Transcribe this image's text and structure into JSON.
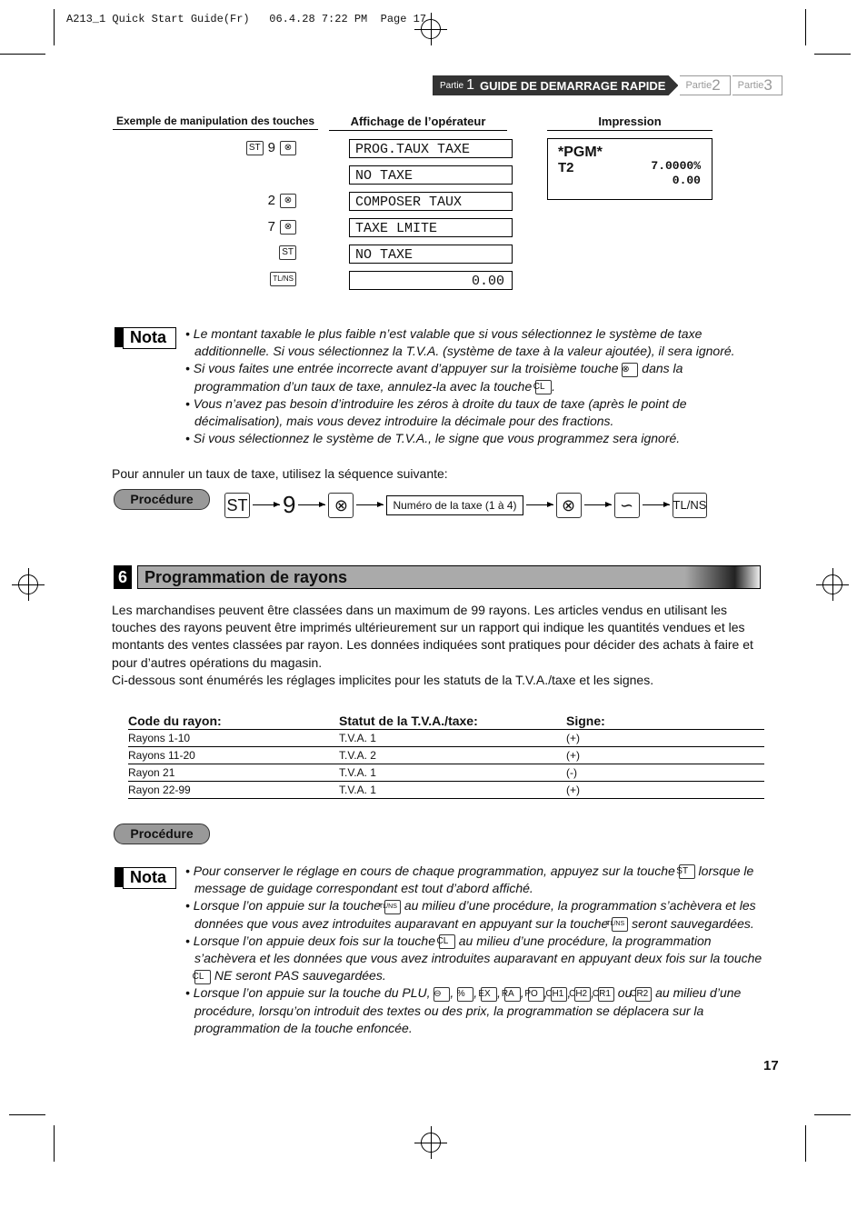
{
  "slug": "A213_1 Quick Start Guide(Fr)   06.4.28 7:22 PM  Page 17",
  "header": {
    "cur_prefix": "Partie",
    "cur_num": "1",
    "cur_title": "GUIDE DE DEMARRAGE RAPIDE",
    "others": [
      {
        "p": "Partie",
        "n": "2"
      },
      {
        "p": "Partie",
        "n": "3"
      }
    ]
  },
  "example": {
    "col1": "Exemple de manipulation des touches",
    "col2": "Affichage de l’opérateur",
    "col3": "Impression",
    "rows": [
      {
        "keys": [
          "ST",
          "9",
          "⊗"
        ],
        "display": "PROG.TAUX TAXE"
      },
      {
        "keys": [],
        "display": "NO TAXE"
      },
      {
        "keys": [
          "2",
          "⊗"
        ],
        "display": "COMPOSER TAUX"
      },
      {
        "keys": [
          "7",
          "⊗"
        ],
        "display": "TAXE LMITE"
      },
      {
        "keys": [
          "ST"
        ],
        "display": "NO TAXE"
      },
      {
        "keys": [
          "TL/NS"
        ],
        "display": "0.00"
      }
    ],
    "print": {
      "line1": "*PGM*",
      "line2_left": "T2",
      "rate": "7.0000%",
      "amount": "0.00"
    }
  },
  "nota_label": "Nota",
  "nota1": [
    [
      {
        "t": "Le montant taxable le plus faible n’est valable que si vous sélectionnez le système de taxe additionnelle. Si vous sélectionnez la T.V.A. (système de taxe à la valeur ajoutée), il sera ignoré."
      }
    ],
    [
      {
        "t": "Si vous faites une entrée incorrecte avant d’appuyer sur la troisième touche "
      },
      {
        "k": "⊗"
      },
      {
        "t": " dans la programmation d’un taux de taxe, annulez-la avec la touche "
      },
      {
        "k": "CL"
      },
      {
        "t": "."
      }
    ],
    [
      {
        "t": "Vous n’avez pas besoin d’introduire les zéros à droite du taux de taxe (après le point de décimalisation), mais vous devez introduire la décimale pour des fractions."
      }
    ],
    [
      {
        "t": "Si vous sélectionnez le système de T.V.A., le signe que vous programmez sera ignoré."
      }
    ]
  ],
  "cancel_text": "Pour annuler un taux de taxe, utilisez la séquence suivante:",
  "procedure_label": "Procédure",
  "sequence": [
    "ST",
    "9",
    "⊗",
    "Numéro de la taxe (1 à 4)",
    "⊗",
    "∽",
    "TL/NS"
  ],
  "section": {
    "number": "6",
    "title": "Programmation de rayons"
  },
  "intro": "Les marchandises peuvent être classées dans un maximum de 99 rayons. Les articles vendus en utilisant les touches des rayons peuvent être imprimés ultérieurement sur un rapport qui indique les quantités vendues et les montants des ventes classées par rayon. Les données indiquées sont pratiques pour décider des achats à faire et pour d’autres opérations du magasin.",
  "intro2": "Ci-dessous sont énumérés les réglages implicites pour les statuts de la T.V.A./taxe et les signes.",
  "table": {
    "headers": [
      "Code du rayon:",
      "Statut de la T.V.A./taxe:",
      "Signe:"
    ],
    "rows": [
      [
        "Rayons 1-10",
        "T.V.A. 1",
        "(+)"
      ],
      [
        "Rayons 11-20",
        "T.V.A. 2",
        "(+)"
      ],
      [
        "Rayon 21",
        "T.V.A. 1",
        "(-)"
      ],
      [
        "Rayon 22-99",
        "T.V.A. 1",
        "(+)"
      ]
    ]
  },
  "nota2": [
    [
      {
        "t": "Pour conserver le réglage en cours de chaque programmation, appuyez sur la touche "
      },
      {
        "k": "ST"
      },
      {
        "t": " lorsque le message de guidage correspondant est tout d’abord affiché."
      }
    ],
    [
      {
        "t": "Lorsque l’on appuie sur la touche "
      },
      {
        "k": "TL/NS"
      },
      {
        "t": " au milieu d’une procédure, la programmation s’achèvera et les données que vous avez introduites auparavant en appuyant sur la touche "
      },
      {
        "k": "TL/NS"
      },
      {
        "t": " seront sauvegardées."
      }
    ],
    [
      {
        "t": "Lorsque l’on appuie deux fois sur la touche "
      },
      {
        "k": "CL"
      },
      {
        "t": " au milieu d’une procédure, la programmation s’achèvera et les données que vous avez introduites auparavant en appuyant deux fois sur la touche "
      },
      {
        "k": "CL"
      },
      {
        "t": " NE seront PAS sauvegardées."
      }
    ],
    [
      {
        "t": "Lorsque l’on appuie sur la touche du PLU, "
      },
      {
        "k": "⊖"
      },
      {
        "t": ", "
      },
      {
        "k": "%"
      },
      {
        "t": ", "
      },
      {
        "k": "EX"
      },
      {
        "t": ", "
      },
      {
        "k": "RA"
      },
      {
        "t": ", "
      },
      {
        "k": "PO"
      },
      {
        "t": ", "
      },
      {
        "k": "CH1"
      },
      {
        "t": ", "
      },
      {
        "k": "CH2"
      },
      {
        "t": ", "
      },
      {
        "k": "CR1"
      },
      {
        "t": " ou "
      },
      {
        "k": "CR2"
      },
      {
        "t": " au milieu d’une procédure, lorsqu’on introduit des textes ou des prix, la programmation se déplacera sur la programmation de la touche enfoncée."
      }
    ]
  ],
  "page_number": "17"
}
